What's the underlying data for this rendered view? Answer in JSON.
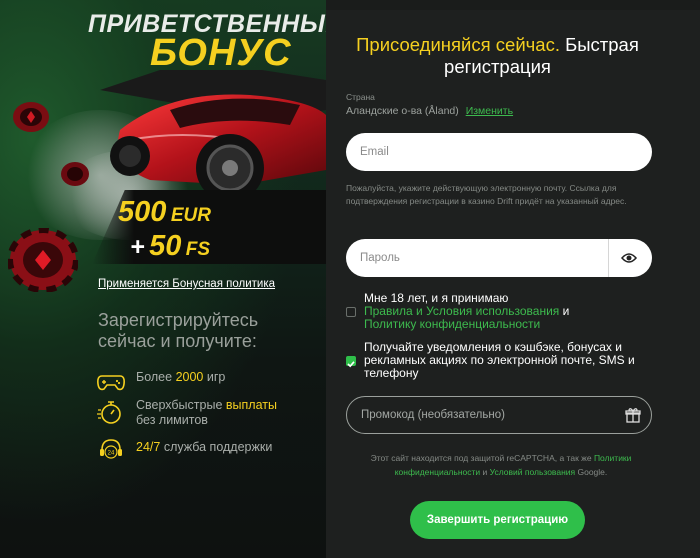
{
  "promo": {
    "title_line1": "ПРИВЕТСТВЕННЫЙ",
    "title_line2": "БОНУС",
    "bonus_amount": "500",
    "bonus_currency": "EUR",
    "fs_plus": "+",
    "fs_amount": "50",
    "fs_unit": "FS",
    "policy_link": "Применяется Бонусная политика",
    "register_heading": "Зарегистрируйтесь сейчас и получите:",
    "features": [
      {
        "icon": "gamepad-icon",
        "before": "Более ",
        "highlight": "2000",
        "after": " игр"
      },
      {
        "icon": "stopwatch-icon",
        "before": "Сверхбыстрые ",
        "highlight": "выплаты",
        "after": " без лимитов"
      },
      {
        "icon": "headset-24-icon",
        "before": "",
        "highlight": "24/7",
        "after": " служба поддержки"
      }
    ]
  },
  "form": {
    "title_highlight": "Присоединяйся сейчас.",
    "title_rest": " Быстрая регистрация",
    "country_label": "Страна",
    "country_value": "Аландские о-ва (Åland)",
    "country_change": "Изменить",
    "email_placeholder": "Email",
    "email_hint": "Пожалуйста, укажите действующую электронную почту. Ссылка для подтверждения регистрации в казино Drift придёт на указанный адрес.",
    "password_placeholder": "Пароль",
    "terms": {
      "checked": false,
      "text_before": "Мне 18 лет, и я принимаю",
      "link1": "Правила и Условия использования",
      "and": " и",
      "link2": "Политику конфиденциальности"
    },
    "notifications": {
      "checked": true,
      "text": "Получайте уведомления о кэшбэке, бонусах и рекламных акциях по электронной почте, SMS и телефону"
    },
    "promo_placeholder": "Промокод (необязательно)",
    "captcha": {
      "text1": "Этот сайт находится под защитой reCAPTCHA, а так же ",
      "link1": "Политики конфиденциальности",
      "text2": " и ",
      "link2": "Условий пользования",
      "text3": " Google."
    },
    "submit_label": "Завершить регистрацию"
  },
  "colors": {
    "accent_yellow": "#f5d020",
    "accent_green": "#2fbf4a",
    "panel_bg": "#1e201f"
  }
}
